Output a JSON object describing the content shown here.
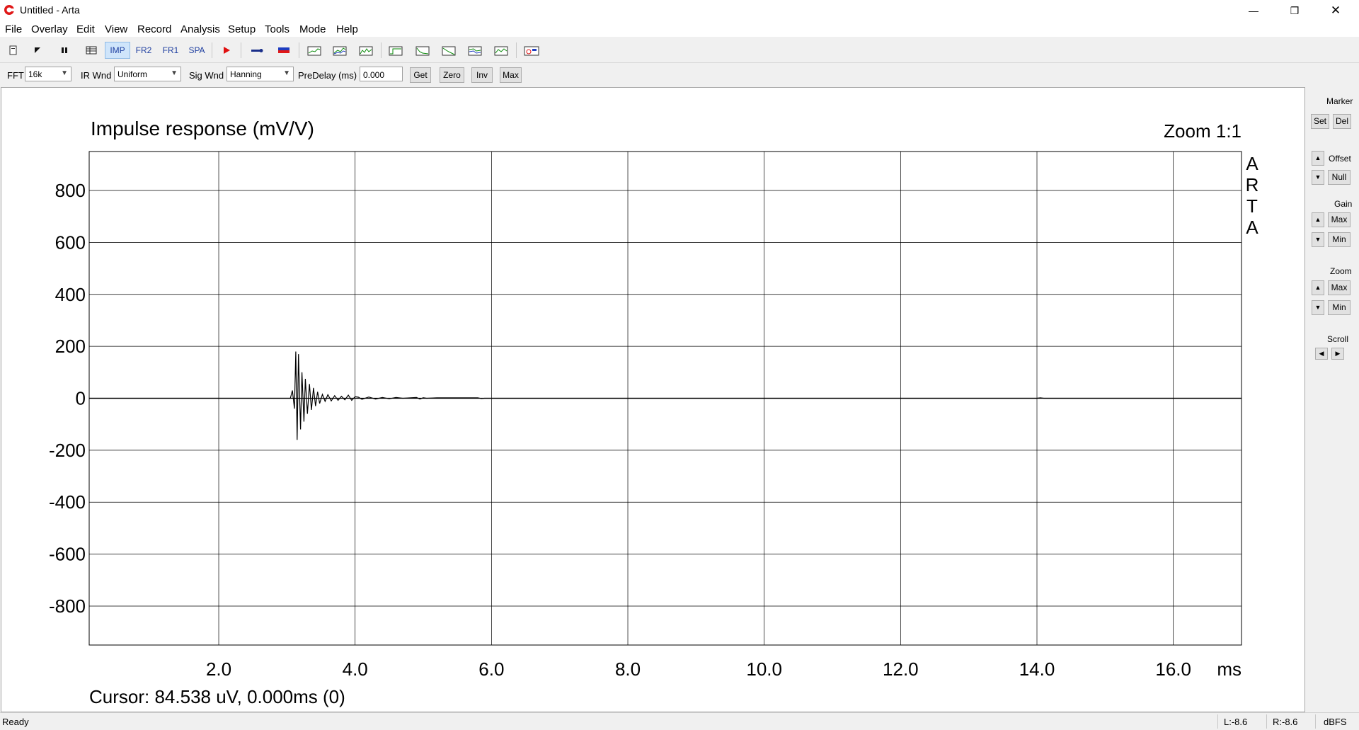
{
  "window": {
    "title": "Untitled - Arta",
    "controls": {
      "minimize": "—",
      "restore": "❐",
      "close": "✕"
    }
  },
  "menu": [
    "File",
    "Overlay",
    "Edit",
    "View",
    "Record",
    "Analysis",
    "Setup",
    "Tools",
    "Mode",
    "Help"
  ],
  "toolbar": {
    "imp_label": "IMP",
    "fr2_label": "FR2",
    "fr1_label": "FR1",
    "spa_label": "SPA",
    "active": "IMP",
    "icons": [
      "new-icon",
      "open-icon",
      "pause-icon",
      "table-icon",
      "record-icon",
      "probe-icon",
      "flag-icon",
      "fr-icon",
      "2fr-icon",
      "fft-icon",
      "step-icon",
      "etc-icon",
      "rev-icon",
      "cs-icon",
      "bd-icon",
      "sti-icon"
    ]
  },
  "options": {
    "fft_label": "FFT",
    "fft_value": "16k",
    "irwnd_label": "IR Wnd",
    "irwnd_value": "Uniform",
    "sigwnd_label": "Sig Wnd",
    "sigwnd_value": "Hanning",
    "predelay_label": "PreDelay (ms)",
    "predelay_value": "0.000",
    "get_label": "Get",
    "zero_label": "Zero",
    "inv_label": "Inv",
    "max_label": "Max"
  },
  "plot": {
    "title": "Impulse response (mV/V)",
    "zoom": "Zoom 1:1",
    "brand_letters": [
      "A",
      "R",
      "T",
      "A"
    ],
    "x_unit": "ms",
    "cursor": "Cursor: 84.538 uV, 0.000ms (0)"
  },
  "chart_data": {
    "type": "line",
    "title": "Impulse response (mV/V)",
    "xlabel": "ms",
    "ylabel": "",
    "xlim": [
      0.1,
      17.0
    ],
    "ylim": [
      -950,
      950
    ],
    "x_ticks": [
      2.0,
      4.0,
      6.0,
      8.0,
      10.0,
      12.0,
      14.0,
      16.0
    ],
    "x_tick_labels": [
      "2.0",
      "4.0",
      "6.0",
      "8.0",
      "10.0",
      "12.0",
      "14.0",
      "16.0"
    ],
    "y_ticks": [
      800,
      600,
      400,
      200,
      0,
      -200,
      -400,
      -600,
      -800
    ],
    "y_tick_labels": [
      "800",
      "600",
      "400",
      "200",
      "0",
      "-200",
      "-400",
      "-600",
      "-800"
    ],
    "grid": true,
    "line_color": "#000000",
    "series": [
      {
        "x": [
          0.1,
          3.05,
          3.08,
          3.11,
          3.13,
          3.15,
          3.17,
          3.2,
          3.22,
          3.25,
          3.27,
          3.3,
          3.33,
          3.36,
          3.39,
          3.42,
          3.45,
          3.48,
          3.52,
          3.56,
          3.6,
          3.65,
          3.7,
          3.75,
          3.8,
          3.85,
          3.9,
          3.95,
          4.0,
          4.05,
          4.1,
          4.2,
          4.3,
          4.4,
          4.5,
          4.6,
          4.7,
          4.9,
          4.95,
          5.0,
          5.05,
          5.2,
          5.5,
          5.8,
          5.85,
          5.9,
          6.8,
          14.0,
          14.05,
          14.1,
          17.0
        ],
        "y": [
          0,
          0,
          30,
          -40,
          180,
          -160,
          170,
          -120,
          100,
          -90,
          75,
          -60,
          55,
          -45,
          40,
          -30,
          25,
          -20,
          15,
          -12,
          14,
          -10,
          10,
          -8,
          8,
          -6,
          12,
          -8,
          6,
          4,
          -4,
          5,
          -3,
          3,
          -2,
          3,
          0,
          3,
          -3,
          2,
          0,
          2,
          2,
          2,
          -1,
          0,
          0,
          0,
          2,
          0,
          0
        ]
      }
    ]
  },
  "right_panel": {
    "marker_label": "Marker",
    "set_label": "Set",
    "del_label": "Del",
    "offset_label": "Offset",
    "null_label": "Null",
    "gain_label": "Gain",
    "gain_max": "Max",
    "gain_min": "Min",
    "zoom_label": "Zoom",
    "zoom_max": "Max",
    "zoom_min": "Min",
    "scroll_label": "Scroll",
    "up_glyph": "▲",
    "down_glyph": "▼",
    "left_glyph": "◀",
    "right_glyph": "▶"
  },
  "status": {
    "ready": "Ready",
    "left_level": "L:-8.6",
    "right_level": "R:-8.6",
    "unit": "dBFS"
  }
}
